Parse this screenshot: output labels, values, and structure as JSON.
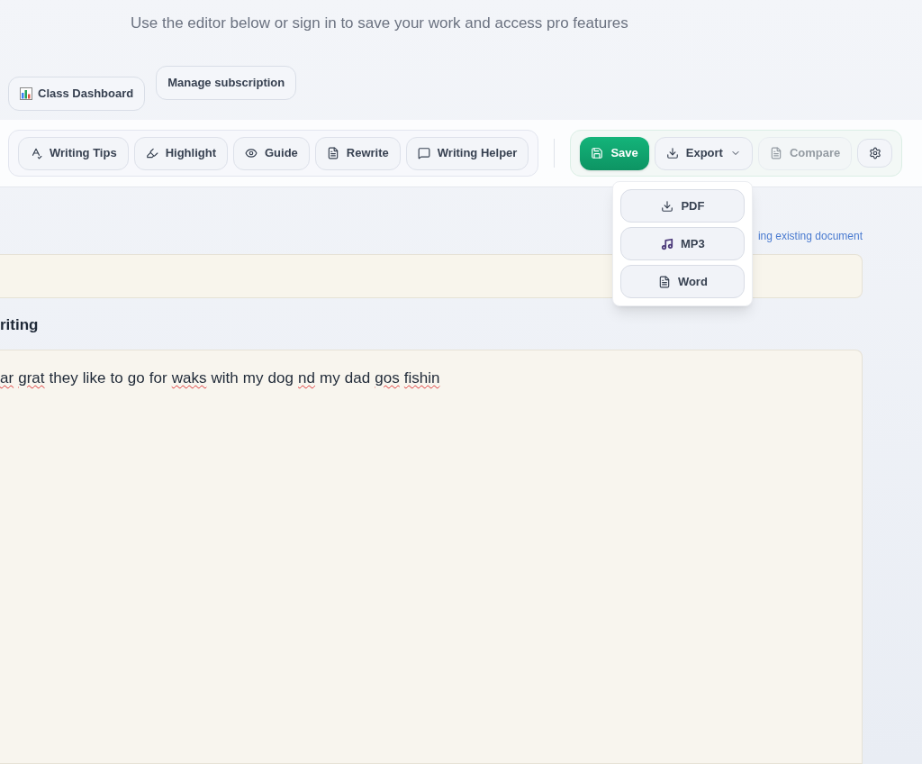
{
  "header": {
    "subtitle": "Use the editor below or sign in to save your work and access pro features",
    "buttons": [
      {
        "label": "Class Dashboard"
      },
      {
        "label": "Manage subscription"
      }
    ]
  },
  "toolbar": {
    "tools": [
      {
        "label": "Writing Tips"
      },
      {
        "label": "Highlight"
      },
      {
        "label": "Guide"
      },
      {
        "label": "Rewrite"
      },
      {
        "label": "Writing Helper"
      }
    ],
    "actions": [
      {
        "label": "Save",
        "kind": "primary",
        "disabled": false
      },
      {
        "label": "Export",
        "kind": "dropdown",
        "disabled": false,
        "expanded": true
      },
      {
        "label": "Compare",
        "kind": "plain",
        "disabled": true
      }
    ],
    "export_menu": [
      {
        "label": "PDF"
      },
      {
        "label": "MP3"
      },
      {
        "label": "Word"
      }
    ]
  },
  "document_link": "ing existing document",
  "section_title": "riting",
  "editor_text": [
    {
      "text": "ar",
      "misspelled": true
    },
    {
      "text": "grat",
      "misspelled": true
    },
    {
      "text": "they",
      "misspelled": false
    },
    {
      "text": "like",
      "misspelled": false
    },
    {
      "text": "to",
      "misspelled": false
    },
    {
      "text": "go",
      "misspelled": false
    },
    {
      "text": "for",
      "misspelled": false
    },
    {
      "text": "waks",
      "misspelled": true
    },
    {
      "text": "with",
      "misspelled": false
    },
    {
      "text": "my",
      "misspelled": false
    },
    {
      "text": "dog",
      "misspelled": false
    },
    {
      "text": "nd",
      "misspelled": true
    },
    {
      "text": "my",
      "misspelled": false
    },
    {
      "text": "dad",
      "misspelled": false
    },
    {
      "text": "gos",
      "misspelled": true
    },
    {
      "text": "fishin",
      "misspelled": true
    }
  ]
}
